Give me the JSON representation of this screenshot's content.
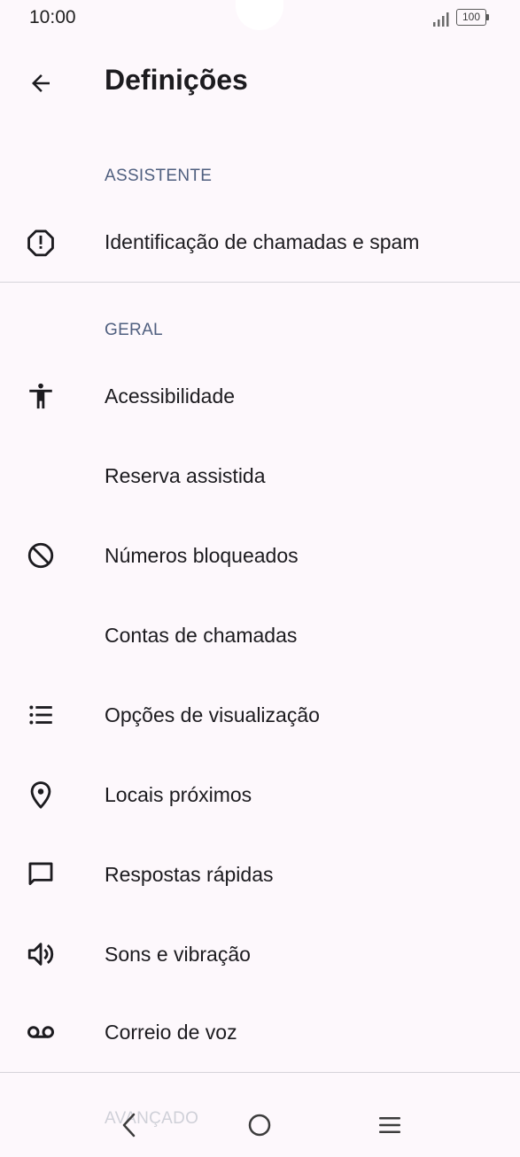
{
  "status_bar": {
    "time": "10:00",
    "battery": "100"
  },
  "header": {
    "title": "Definições"
  },
  "sections": {
    "assistant": {
      "title": "ASSISTENTE",
      "items": [
        {
          "label": "Identificação de chamadas e spam",
          "icon": "alert-octagon-icon"
        }
      ]
    },
    "general": {
      "title": "GERAL",
      "items": [
        {
          "label": "Acessibilidade",
          "icon": "accessibility-icon"
        },
        {
          "label": "Reserva assistida",
          "icon": ""
        },
        {
          "label": "Números bloqueados",
          "icon": "block-icon"
        },
        {
          "label": "Contas de chamadas",
          "icon": ""
        },
        {
          "label": "Opções de visualização",
          "icon": "list-icon"
        },
        {
          "label": "Locais próximos",
          "icon": "location-pin-icon"
        },
        {
          "label": "Respostas rápidas",
          "icon": "message-icon"
        },
        {
          "label": "Sons e vibração",
          "icon": "volume-icon"
        },
        {
          "label": "Correio de voz",
          "icon": "voicemail-icon"
        }
      ]
    },
    "advanced": {
      "title": "AVANÇADO"
    }
  },
  "nav_bar": {
    "buttons": [
      "back",
      "home",
      "recents"
    ]
  }
}
